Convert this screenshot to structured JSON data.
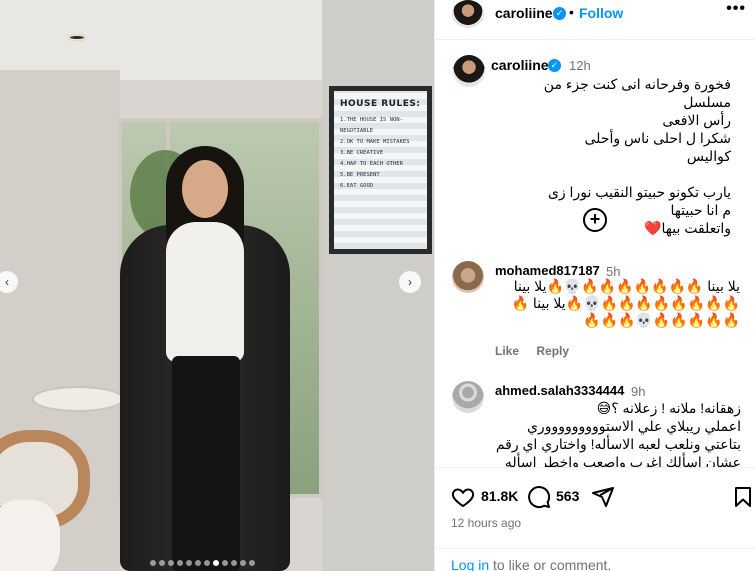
{
  "header": {
    "username": "caroliine",
    "bullet": "•",
    "follow_label": "Follow",
    "more_label": "•••"
  },
  "caption": {
    "username": "caroliine",
    "time": "12h",
    "lines": [
      "فخورة وفرحانه انى كنت جزء من مسلسل",
      "رأس الافعى",
      "شكرا ل احلى ناس وأحلى كواليس",
      "",
      "يارب تكونو حبيتو النقيب نورا زى م انا حبيتها",
      "واتعلقت بيها❤️"
    ]
  },
  "add_button": {
    "label": "+"
  },
  "comments": [
    {
      "username": "mohamed817187",
      "time": "5h",
      "text": "يلا بينا 🔥🔥🔥🔥🔥🔥🔥💀🔥يلا بينا 🔥🔥🔥🔥🔥🔥🔥🔥💀🔥يلا بينا 🔥🔥🔥🔥🔥🔥💀🔥🔥🔥"
    },
    {
      "username": "ahmed.salah3334444",
      "time": "9h",
      "lines": [
        "زهقانه! ملانه ! زعلانه ؟😅",
        "اعملي ريبلاي علي الاستوووووووووري",
        "بتاعتي ونلعب لعبه الاسأله! واختاري اي رقم",
        "عشان اسألك اغرب واصعب واخطر اسأله"
      ]
    }
  ],
  "comment_actions": {
    "like": "Like",
    "reply": "Reply"
  },
  "actions": {
    "likes": "81.8K",
    "comments": "563",
    "time": "12 hours ago"
  },
  "login": {
    "link": "Log in",
    "rest": " to like or comment."
  },
  "media": {
    "poster_title": "HOUSE RULES:",
    "poster_rules": [
      "1.THE HOUSE IS NON-",
      "NEGOTIABLE",
      "2.OK TO MAKE MISTAKES",
      "3.BE CREATIVE",
      "4.HAP TO EACH OTHER",
      "5.BE PRESENT",
      "6.EAT GOOD"
    ],
    "prev_label": "‹",
    "next_label": "›"
  }
}
